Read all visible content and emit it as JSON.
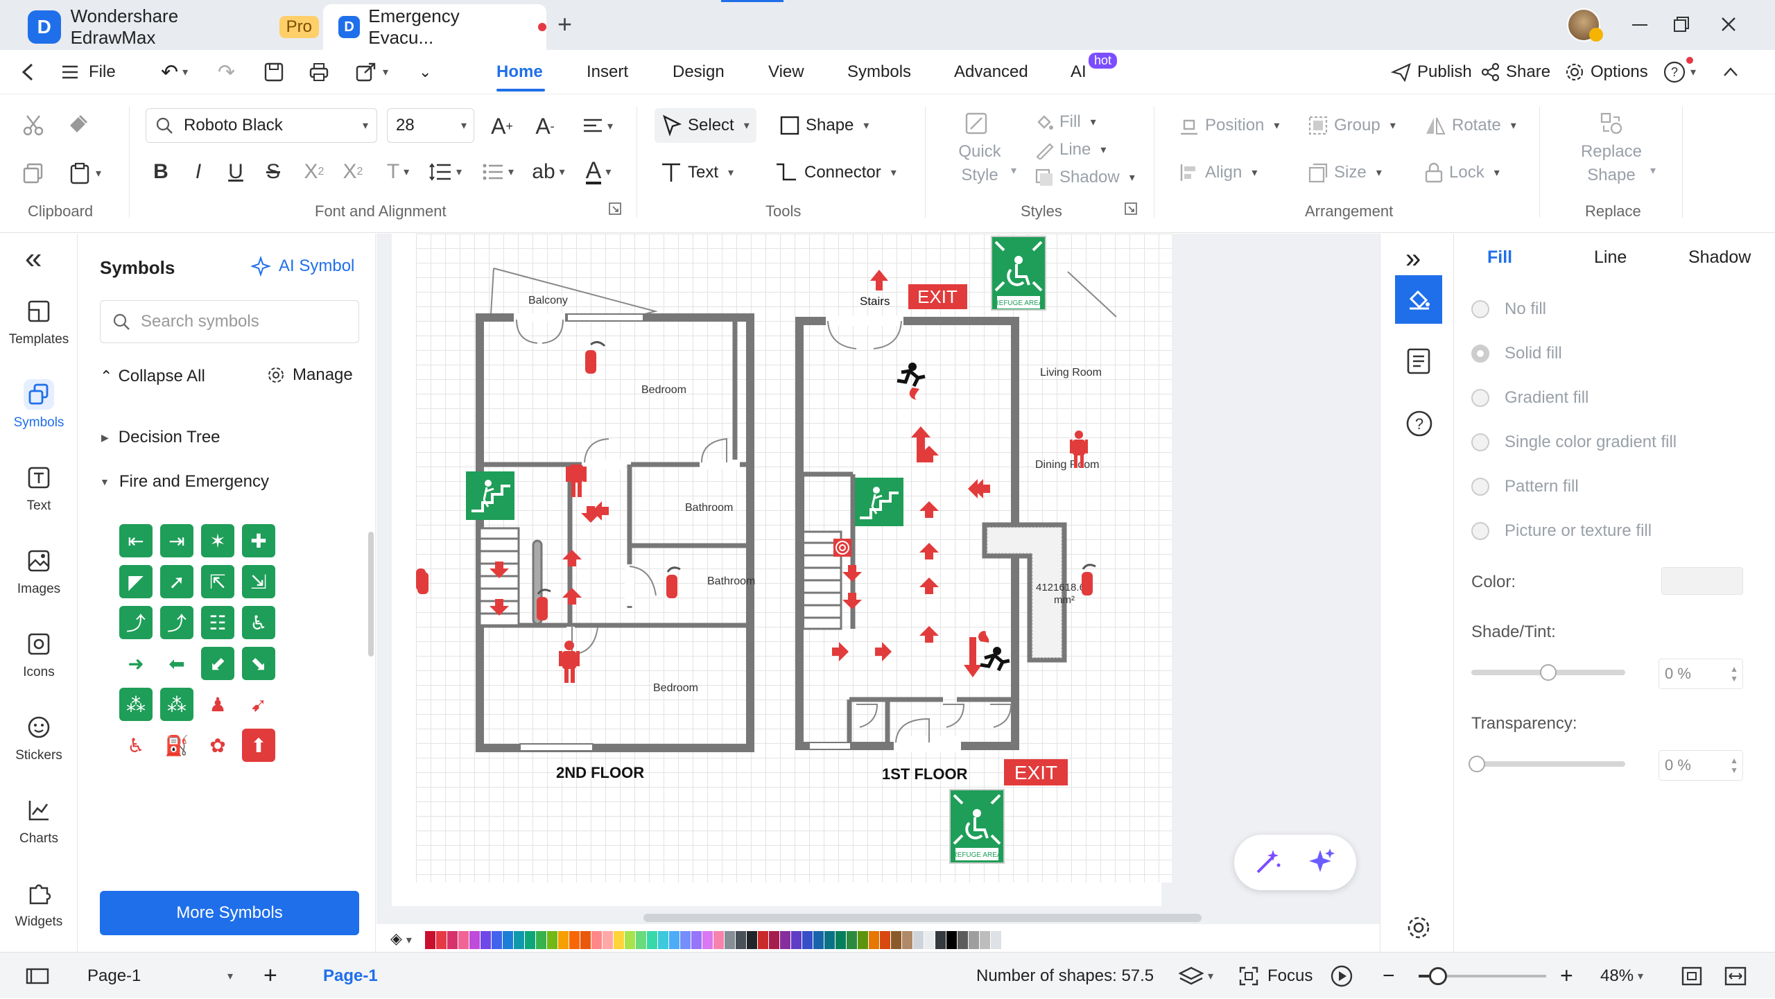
{
  "titlebar": {
    "app_name": "Wondershare EdrawMax",
    "badge": "Pro",
    "doc_tab": "Emergency Evacu...",
    "new_tab": "+",
    "window_buttons": [
      "minimize-icon",
      "restore-icon",
      "close-icon"
    ]
  },
  "menubar": {
    "back": "<",
    "file": "File",
    "tabs": [
      "Home",
      "Insert",
      "Design",
      "View",
      "Symbols",
      "Advanced",
      "AI"
    ],
    "ai_badge": "hot",
    "active_tab": "Home",
    "publish": "Publish",
    "share": "Share",
    "options": "Options"
  },
  "ribbon": {
    "clipboard_label": "Clipboard",
    "font_family": "Roboto Black",
    "font_size": "28",
    "font_group_label": "Font and Alignment",
    "select": "Select",
    "shape": "Shape",
    "text": "Text",
    "connector": "Connector",
    "tools_label": "Tools",
    "quick_style": "Quick Style",
    "fill": "Fill",
    "line": "Line",
    "shadow": "Shadow",
    "styles_label": "Styles",
    "position": "Position",
    "group": "Group",
    "rotate": "Rotate",
    "align": "Align",
    "size": "Size",
    "lock": "Lock",
    "arrangement_label": "Arrangement",
    "replace_shape": "Replace Shape",
    "replace_label": "Replace"
  },
  "leftbar": {
    "collapse": "«",
    "items": [
      "Templates",
      "Symbols",
      "Text",
      "Images",
      "Icons",
      "Stickers",
      "Charts",
      "Widgets"
    ],
    "active": "Symbols"
  },
  "symbols_panel": {
    "title": "Symbols",
    "ai_symbol": "AI Symbol",
    "search_placeholder": "Search symbols",
    "collapse_all": "Collapse All",
    "manage": "Manage",
    "categories": [
      "Decision Tree",
      "Fire and Emergency"
    ],
    "more_symbols": "More Symbols"
  },
  "diagram": {
    "labels": {
      "balcony": "Balcony",
      "bedroom1": "Bedroom",
      "bathroom1": "Bathroom",
      "bathroom2": "Bathroom",
      "bedroom2": "Bedroom",
      "floor2": "2ND FLOOR",
      "stairs": "Stairs",
      "exit_top": "EXIT",
      "living": "Living Room",
      "dining": "Dining Room",
      "area_value": "4121618.66",
      "area_unit": "mm²",
      "floor1": "1ST FLOOR",
      "exit_bottom": "EXIT",
      "refuge_top": "REFUGE AREA",
      "refuge_bottom": "REFUGE AREA"
    },
    "colors": {
      "wall": "#777777",
      "sign_green": "#1e9e58",
      "danger_red": "#e23b3b"
    }
  },
  "right_panel": {
    "tabs": [
      "Fill",
      "Line",
      "Shadow"
    ],
    "active_tab": "Fill",
    "fill_options": [
      "No fill",
      "Solid fill",
      "Gradient fill",
      "Single color gradient fill",
      "Pattern fill",
      "Picture or texture fill"
    ],
    "color_label": "Color:",
    "shade_label": "Shade/Tint:",
    "shade_value": "0 %",
    "shade_level": 0.5,
    "transparency_label": "Transparency:",
    "transparency_value": "0 %",
    "transparency_level": 0
  },
  "statusbar": {
    "page_select": "Page-1",
    "add_page": "+",
    "page_tab": "Page-1",
    "shape_count": "Number of shapes: 57.5",
    "focus": "Focus",
    "zoom": "48%",
    "zoom_level": 0.48
  },
  "palette": [
    "#c8102e",
    "#e63946",
    "#d6336c",
    "#f06595",
    "#be4bdb",
    "#7048e8",
    "#4263eb",
    "#1c7ed6",
    "#1098ad",
    "#0ca678",
    "#37b24d",
    "#74b816",
    "#f59f00",
    "#f76707",
    "#e8590c",
    "#ff8787",
    "#ffa8a8",
    "#ffd43b",
    "#a9e34b",
    "#69db7c",
    "#38d9a9",
    "#3bc9db",
    "#4dabf7",
    "#748ffc",
    "#9775fa",
    "#da77f2",
    "#f783ac",
    "#868e96",
    "#495057",
    "#212529",
    "#c92a2a",
    "#a61e4d",
    "#862e9c",
    "#5f3dc4",
    "#364fc7",
    "#1864ab",
    "#0b7285",
    "#087f5b",
    "#2b8a3e",
    "#5c940d",
    "#e67700",
    "#d9480f",
    "#8b5a2b",
    "#b08968",
    "#ced4da",
    "#e9ecef",
    "#343a40",
    "#000000",
    "#5c5c5c",
    "#9e9e9e",
    "#bdbdbd",
    "#dee2e6"
  ]
}
